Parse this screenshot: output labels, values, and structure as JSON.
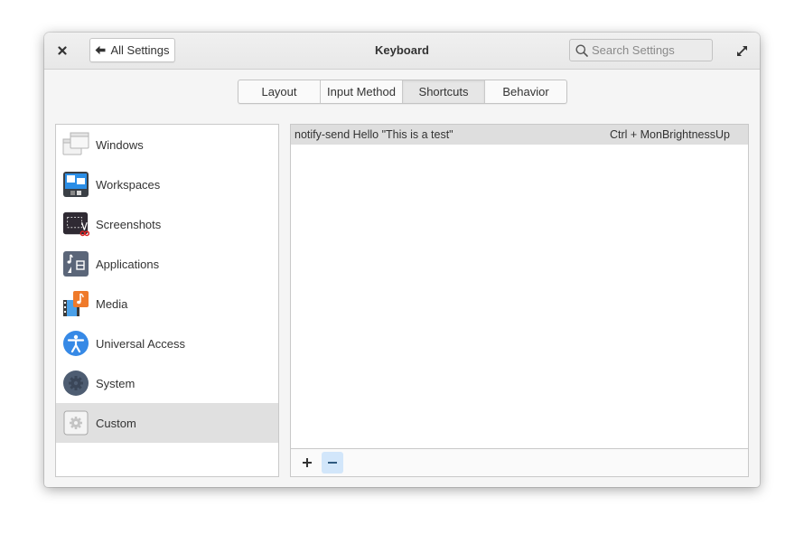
{
  "window": {
    "title": "Keyboard",
    "close_icon": "close-icon",
    "maximize_icon": "maximize-icon"
  },
  "header": {
    "back_button_label": "All Settings",
    "back_icon": "arrow-left-icon",
    "search": {
      "placeholder": "Search Settings",
      "value": "",
      "icon": "search-icon"
    }
  },
  "tabs": [
    {
      "label": "Layout",
      "active": false
    },
    {
      "label": "Input Method",
      "active": false
    },
    {
      "label": "Shortcuts",
      "active": true
    },
    {
      "label": "Behavior",
      "active": false
    }
  ],
  "sidebar": {
    "items": [
      {
        "label": "Windows",
        "icon": "windows-icon",
        "selected": false
      },
      {
        "label": "Workspaces",
        "icon": "workspaces-icon",
        "selected": false
      },
      {
        "label": "Screenshots",
        "icon": "screenshots-icon",
        "selected": false
      },
      {
        "label": "Applications",
        "icon": "applications-icon",
        "selected": false
      },
      {
        "label": "Media",
        "icon": "media-icon",
        "selected": false
      },
      {
        "label": "Universal Access",
        "icon": "accessibility-icon",
        "selected": false
      },
      {
        "label": "System",
        "icon": "system-gear-icon",
        "selected": false
      },
      {
        "label": "Custom",
        "icon": "custom-gear-icon",
        "selected": true
      }
    ]
  },
  "shortcuts": {
    "rows": [
      {
        "command": "notify-send Hello \"This is a test\"",
        "accelerator": "Ctrl + MonBrightnessUp",
        "selected": true
      }
    ],
    "toolbar": {
      "add_label": "+",
      "remove_label": "−"
    }
  },
  "colors": {
    "accent_hover": "#d2e6fa",
    "remove_icon": "#2f5a80",
    "selected_row": "#dedede"
  }
}
